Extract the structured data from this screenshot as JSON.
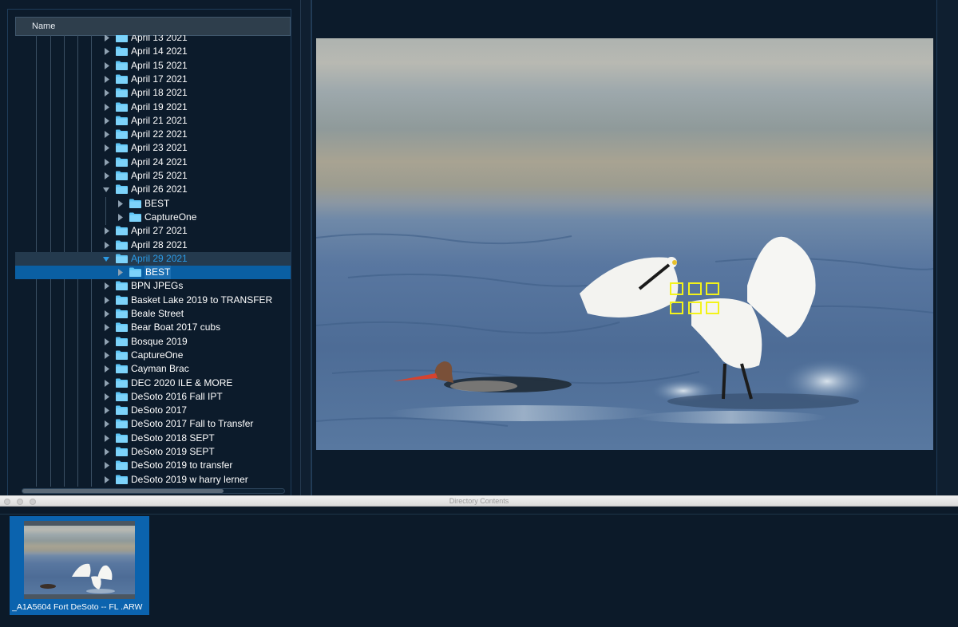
{
  "tree": {
    "header": "Name",
    "rows": [
      {
        "label": "April 13 2021",
        "depth": 0,
        "state": "closed"
      },
      {
        "label": "April 14 2021",
        "depth": 0,
        "state": "closed"
      },
      {
        "label": "April 15 2021",
        "depth": 0,
        "state": "closed"
      },
      {
        "label": "April 17 2021",
        "depth": 0,
        "state": "closed"
      },
      {
        "label": "April 18 2021",
        "depth": 0,
        "state": "closed"
      },
      {
        "label": "April 19 2021",
        "depth": 0,
        "state": "closed"
      },
      {
        "label": "April 21 2021",
        "depth": 0,
        "state": "closed"
      },
      {
        "label": "April 22 2021",
        "depth": 0,
        "state": "closed"
      },
      {
        "label": "April 23 2021",
        "depth": 0,
        "state": "closed"
      },
      {
        "label": "April 24 2021",
        "depth": 0,
        "state": "closed"
      },
      {
        "label": "April 25 2021",
        "depth": 0,
        "state": "closed"
      },
      {
        "label": "April 26 2021",
        "depth": 0,
        "state": "open"
      },
      {
        "label": "BEST",
        "depth": 1,
        "state": "closed"
      },
      {
        "label": "CaptureOne",
        "depth": 1,
        "state": "closed"
      },
      {
        "label": "April 27 2021",
        "depth": 0,
        "state": "closed"
      },
      {
        "label": "April 28 2021",
        "depth": 0,
        "state": "closed"
      },
      {
        "label": "April 29 2021",
        "depth": 0,
        "state": "open",
        "highlight": true
      },
      {
        "label": "BEST",
        "depth": 1,
        "state": "closed",
        "selected": true
      },
      {
        "label": "BPN JPEGs",
        "depth": 0,
        "state": "closed"
      },
      {
        "label": "Basket Lake 2019 to TRANSFER",
        "depth": 0,
        "state": "closed"
      },
      {
        "label": "Beale Street",
        "depth": 0,
        "state": "closed"
      },
      {
        "label": "Bear Boat 2017 cubs",
        "depth": 0,
        "state": "closed"
      },
      {
        "label": "Bosque 2019",
        "depth": 0,
        "state": "closed"
      },
      {
        "label": "CaptureOne",
        "depth": 0,
        "state": "closed"
      },
      {
        "label": "Cayman Brac",
        "depth": 0,
        "state": "closed"
      },
      {
        "label": "DEC 2020 ILE & MORE",
        "depth": 0,
        "state": "closed"
      },
      {
        "label": "DeSoto 2016 Fall IPT",
        "depth": 0,
        "state": "closed"
      },
      {
        "label": "DeSoto 2017",
        "depth": 0,
        "state": "closed"
      },
      {
        "label": "DeSoto 2017 Fall to Transfer",
        "depth": 0,
        "state": "closed"
      },
      {
        "label": "DeSoto 2018 SEPT",
        "depth": 0,
        "state": "closed"
      },
      {
        "label": "DeSoto 2019 SEPT",
        "depth": 0,
        "state": "closed"
      },
      {
        "label": "DeSoto 2019 to transfer",
        "depth": 0,
        "state": "closed"
      },
      {
        "label": "DeSoto 2019 w harry lerner",
        "depth": 0,
        "state": "closed"
      }
    ]
  },
  "contents_window": {
    "title": "Directory Contents",
    "files": [
      {
        "name": "_A1A5604 Fort DeSoto -- FL .ARW"
      }
    ]
  },
  "colors": {
    "panel_bg": "#0c1b2b",
    "selection": "#0a5fa3",
    "folder": "#5cc4f5",
    "focus_point": "#f3f31a"
  }
}
